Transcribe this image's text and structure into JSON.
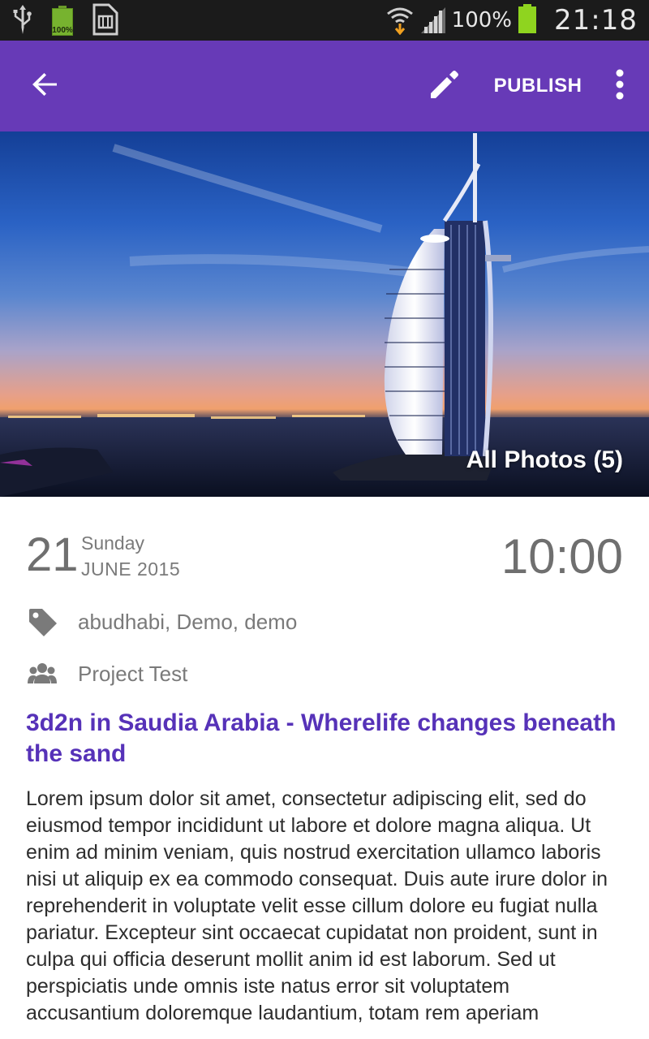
{
  "status_bar": {
    "battery_left_label": "100%",
    "battery_percent": "100%",
    "clock": "21:18",
    "icons": [
      "usb-icon",
      "battery-icon",
      "sim-icon",
      "wifi-icon",
      "signal-icon",
      "battery-icon"
    ]
  },
  "app_bar": {
    "publish_label": "PUBLISH",
    "color": "#673ab7",
    "icons": [
      "back-arrow-icon",
      "edit-pencil-icon",
      "more-vert-icon"
    ]
  },
  "hero": {
    "all_photos_label": "All Photos (5)"
  },
  "entry": {
    "day": "21",
    "weekday": "Sunday",
    "month_year": "JUNE 2015",
    "time": "10:00",
    "tags": "abudhabi, Demo, demo",
    "project": "Project Test",
    "title": "3d2n in Saudia Arabia - Wherelife changes beneath the sand",
    "title_color": "#5632b8",
    "body": "Lorem ipsum dolor sit amet, consectetur adipiscing elit, sed do eiusmod tempor incididunt ut labore et dolore magna aliqua. Ut enim ad minim veniam, quis nostrud exercitation ullamco laboris nisi ut aliquip ex ea commodo consequat. Duis aute irure dolor in reprehenderit in voluptate velit esse cillum dolore eu fugiat nulla pariatur. Excepteur sint occaecat cupidatat non proident, sunt in culpa qui officia deserunt mollit anim id est laborum. Sed ut perspiciatis unde omnis iste natus error sit voluptatem accusantium doloremque laudantium, totam rem aperiam"
  }
}
